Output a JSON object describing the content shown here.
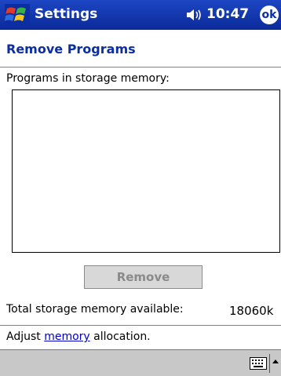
{
  "titlebar": {
    "app_title": "Settings",
    "clock": "10:47",
    "ok_label": "ok",
    "start_icon": "windows-flag-icon",
    "volume_icon": "speaker-icon"
  },
  "page": {
    "title": "Remove Programs",
    "programs_label": "Programs in storage memory:",
    "program_list_items": [],
    "remove_button_label": "Remove",
    "storage_label": "Total storage memory available:",
    "storage_value": "18060k"
  },
  "footer": {
    "adjust_prefix": "Adjust ",
    "memory_link": "memory",
    "adjust_suffix": " allocation."
  },
  "menubar": {
    "input_icon": "keyboard-icon",
    "input_arrow_icon": "chevron-up-icon"
  },
  "colors": {
    "titlebar_blue": "#0b2ea3",
    "title_text_blue": "#0b2ea3",
    "link_blue": "#0000cc",
    "disabled_gray": "#8a8a8a",
    "menubar_gray": "#c8c8c8"
  }
}
